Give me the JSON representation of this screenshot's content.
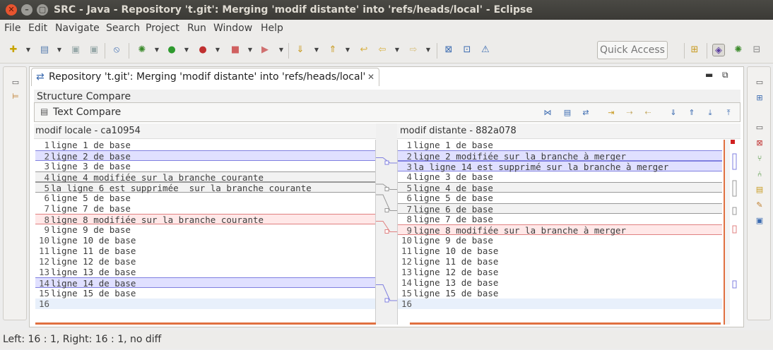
{
  "window": {
    "title": "SRC - Java - Repository 't.git': Merging 'modif distante' into 'refs/heads/local' - Eclipse"
  },
  "menu": {
    "items": [
      "File",
      "Edit",
      "Navigate",
      "Search",
      "Project",
      "Run",
      "Window",
      "Help"
    ]
  },
  "toolbar": {
    "quick_access": "Quick Access"
  },
  "editor": {
    "tab_label": "Repository 't.git': Merging 'modif distante' into 'refs/heads/local'",
    "structure_compare": "Structure Compare",
    "text_compare": "Text Compare",
    "left_header": "modif locale - ca10954",
    "right_header": "modif distante - 882a078",
    "left_lines": [
      {
        "n": "1",
        "t": "ligne 1 de base"
      },
      {
        "n": "2",
        "t": "ligne 2 de base"
      },
      {
        "n": "3",
        "t": "ligne 3 de base"
      },
      {
        "n": "4",
        "t": "ligne 4 modifiée sur la branche courante"
      },
      {
        "n": "5",
        "t": "la ligne 6 est supprimée  sur la branche courante"
      },
      {
        "n": "6",
        "t": "ligne 5 de base"
      },
      {
        "n": "7",
        "t": "ligne 7 de base"
      },
      {
        "n": "8",
        "t": "ligne 8 modifiée sur la branche courante"
      },
      {
        "n": "9",
        "t": "ligne 9 de base"
      },
      {
        "n": "10",
        "t": "ligne 10 de base"
      },
      {
        "n": "11",
        "t": "ligne 11 de base"
      },
      {
        "n": "12",
        "t": "ligne 12 de base"
      },
      {
        "n": "13",
        "t": "ligne 13 de base"
      },
      {
        "n": "14",
        "t": "ligne 14 de base"
      },
      {
        "n": "15",
        "t": "ligne 15 de base"
      },
      {
        "n": "16",
        "t": ""
      }
    ],
    "right_lines": [
      {
        "n": "1",
        "t": "ligne 1 de base"
      },
      {
        "n": "2",
        "t": "ligne 2 modifiée sur la branche à merger"
      },
      {
        "n": "3",
        "t": "la ligne 14 est supprimé sur la branche à merger"
      },
      {
        "n": "4",
        "t": "ligne 3 de base"
      },
      {
        "n": "5",
        "t": "ligne 4 de base"
      },
      {
        "n": "6",
        "t": "ligne 5 de base"
      },
      {
        "n": "7",
        "t": "ligne 6 de base"
      },
      {
        "n": "8",
        "t": "ligne 7 de base"
      },
      {
        "n": "9",
        "t": "ligne 8 modifiée sur la branche à merger"
      },
      {
        "n": "10",
        "t": "ligne 9 de base"
      },
      {
        "n": "11",
        "t": "ligne 10 de base"
      },
      {
        "n": "12",
        "t": "ligne 11 de base"
      },
      {
        "n": "13",
        "t": "ligne 12 de base"
      },
      {
        "n": "14",
        "t": "ligne 13 de base"
      },
      {
        "n": "15",
        "t": "ligne 15 de base"
      },
      {
        "n": "16",
        "t": ""
      }
    ]
  },
  "status": {
    "text": "Left: 16 : 1, Right: 16 : 1, no diff"
  },
  "colors": {
    "incoming_bg": "#e0e0ff",
    "incoming_border": "#8080e0",
    "conflict_bg": "#ffe8e8",
    "conflict_border": "#e08080",
    "change_bg": "#f2f2f2",
    "change_border": "#999999",
    "cursor_line": "#e8f0fb"
  }
}
